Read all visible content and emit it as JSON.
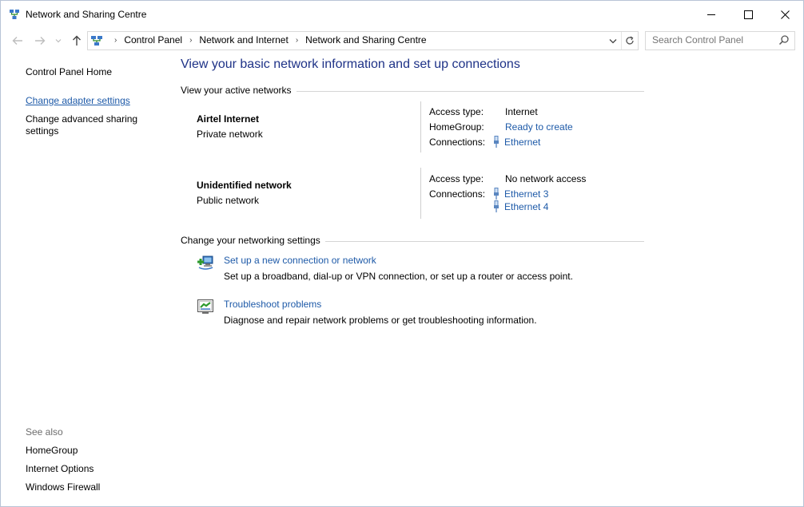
{
  "window": {
    "title": "Network and Sharing Centre"
  },
  "address": {
    "crumbs": [
      "Control Panel",
      "Network and Internet",
      "Network and Sharing Centre"
    ]
  },
  "search": {
    "placeholder": "Search Control Panel"
  },
  "left": {
    "home": "Control Panel Home",
    "links": [
      "Change adapter settings",
      "Change advanced sharing settings"
    ],
    "see_also_title": "See also",
    "see_also": [
      "HomeGroup",
      "Internet Options",
      "Windows Firewall"
    ]
  },
  "main": {
    "title": "View your basic network information and set up connections",
    "active_heading": "View your active networks",
    "networks": [
      {
        "name": "Airtel Internet",
        "type": "Private network",
        "access_label": "Access type:",
        "access_value": "Internet",
        "homegroup_label": "HomeGroup:",
        "homegroup_value": "Ready to create",
        "connections_label": "Connections:",
        "connections": [
          "Ethernet"
        ]
      },
      {
        "name": "Unidentified network",
        "type": "Public network",
        "access_label": "Access type:",
        "access_value": "No network access",
        "connections_label": "Connections:",
        "connections": [
          "Ethernet 3",
          "Ethernet 4"
        ]
      }
    ],
    "settings_heading": "Change your networking settings",
    "tasks": [
      {
        "link": "Set up a new connection or network",
        "desc": "Set up a broadband, dial-up or VPN connection, or set up a router or access point."
      },
      {
        "link": "Troubleshoot problems",
        "desc": "Diagnose and repair network problems or get troubleshooting information."
      }
    ]
  },
  "colors": {
    "link": "#1e5aa8",
    "title": "#1e3287"
  }
}
